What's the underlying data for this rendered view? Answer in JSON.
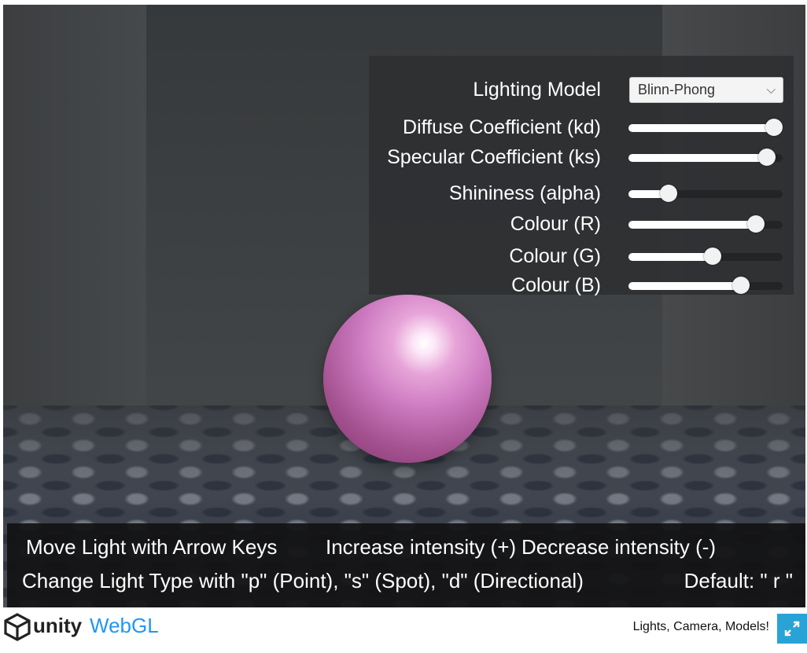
{
  "scene": {
    "sphere_color": "#cc7ac0"
  },
  "panel": {
    "lighting_model": {
      "label": "Lighting Model",
      "value": "Blinn-Phong"
    },
    "sliders": [
      {
        "label": "Diffuse Coefficient (kd)",
        "value": 1.0
      },
      {
        "label": "Specular Coefficient (ks)",
        "value": 0.95
      },
      {
        "label": "Shininess (alpha)",
        "value": 0.23
      },
      {
        "label": "Colour (R)",
        "value": 0.87
      },
      {
        "label": "Colour (G)",
        "value": 0.55
      },
      {
        "label": "Colour (B)",
        "value": 0.76
      }
    ]
  },
  "instructions": {
    "move": "Move Light with Arrow Keys",
    "increase": "Increase intensity (+)",
    "decrease": "Decrease intensity (-)",
    "change_type": "Change Light Type with \"p\" (Point), \"s\" (Spot), \"d\" (Directional)",
    "default": "Default: \" r \""
  },
  "footer": {
    "logo_unity": "unity",
    "logo_webgl": "WebGL",
    "title": "Lights, Camera, Models!",
    "fullscreen_icon": "expand-icon"
  },
  "colors": {
    "accent": "#29a3d6",
    "webgl_text": "#2196f3"
  }
}
